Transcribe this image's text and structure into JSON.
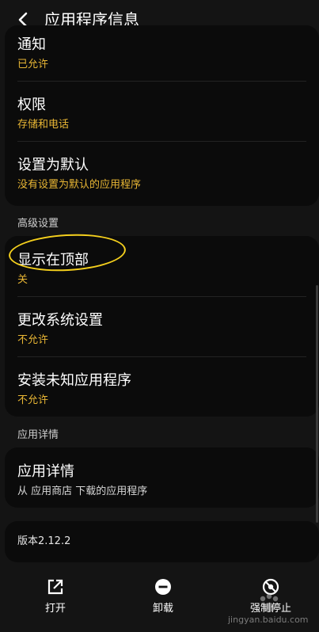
{
  "header": {
    "title": "应用程序信息"
  },
  "top_card": {
    "items": [
      {
        "title": "通知",
        "subtitle": "已允许"
      },
      {
        "title": "权限",
        "subtitle": "存储和电话"
      },
      {
        "title": "设置为默认",
        "subtitle": "没有设置为默认的应用程序"
      }
    ]
  },
  "advanced": {
    "label": "高级设置",
    "items": [
      {
        "title": "显示在顶部",
        "subtitle": "关"
      },
      {
        "title": "更改系统设置",
        "subtitle": "不允许"
      },
      {
        "title": "安装未知应用程序",
        "subtitle": "不允许"
      }
    ]
  },
  "details": {
    "label": "应用详情",
    "item": {
      "title": "应用详情",
      "subtitle": "从 应用商店 下载的应用程序"
    }
  },
  "version": {
    "text": "版本2.12.2"
  },
  "bottom": {
    "open_label": "打开",
    "uninstall_label": "卸载",
    "force_stop_label": "强制停止"
  },
  "watermark": {
    "text": "jingyan.baidu.com"
  },
  "colors": {
    "accent": "#e8b634",
    "highlight": "#f4cf1d",
    "background": "#141414",
    "card": "#0b0b0b"
  }
}
